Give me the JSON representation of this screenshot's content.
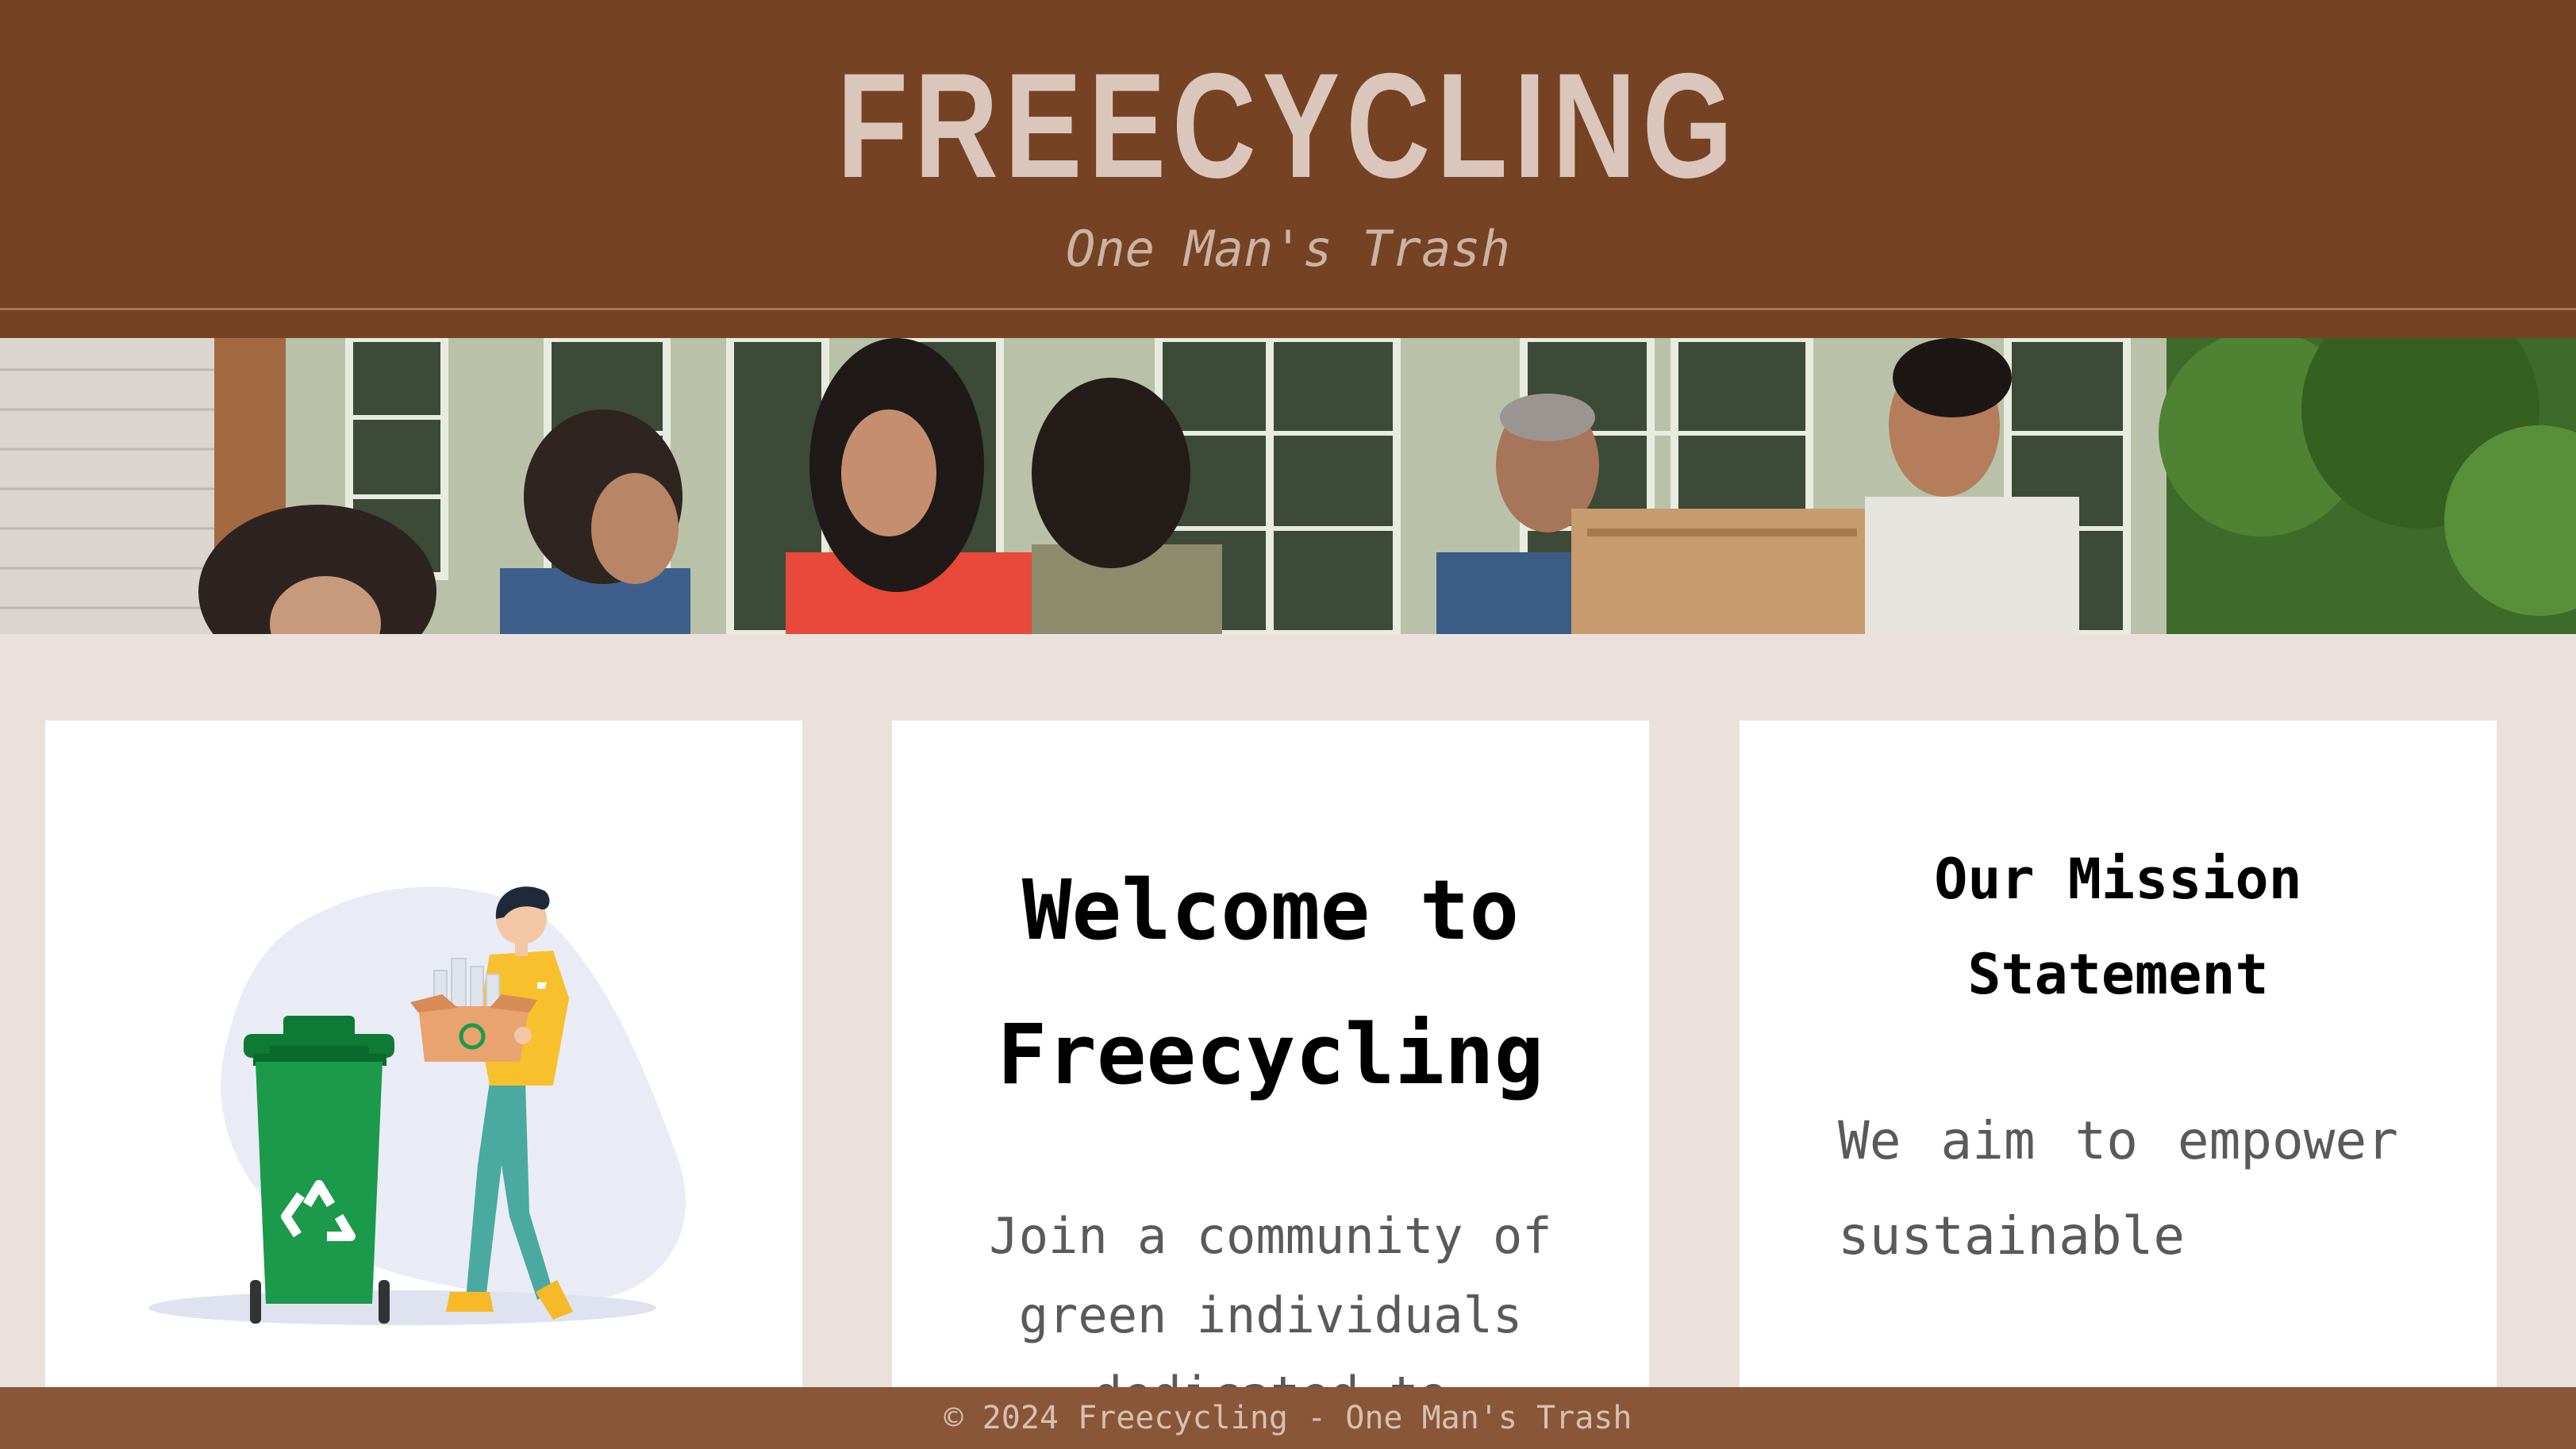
{
  "header": {
    "title": "FREECYCLING",
    "tagline": "One Man's Trash"
  },
  "banner": {
    "image": "photo of neighbors exchanging a cardboard box"
  },
  "cards": {
    "illustration": {
      "image": "person carrying box of bottles next to green recycling bin"
    },
    "welcome": {
      "title": "Welcome to Freecycling",
      "text": "Join a community of green individuals dedicated to"
    },
    "mission": {
      "title": "Our Mission Statement",
      "text": "We aim to empower sustainable"
    }
  },
  "footer": {
    "text": "© 2024 Freecycling - One Man's Trash"
  },
  "colors": {
    "header_bg": "#754224",
    "title": "#dbc6bc",
    "page_bg": "#ebe1dc",
    "footer_bg": "#8a5638",
    "recycle_bin": "#1a9a4a"
  }
}
